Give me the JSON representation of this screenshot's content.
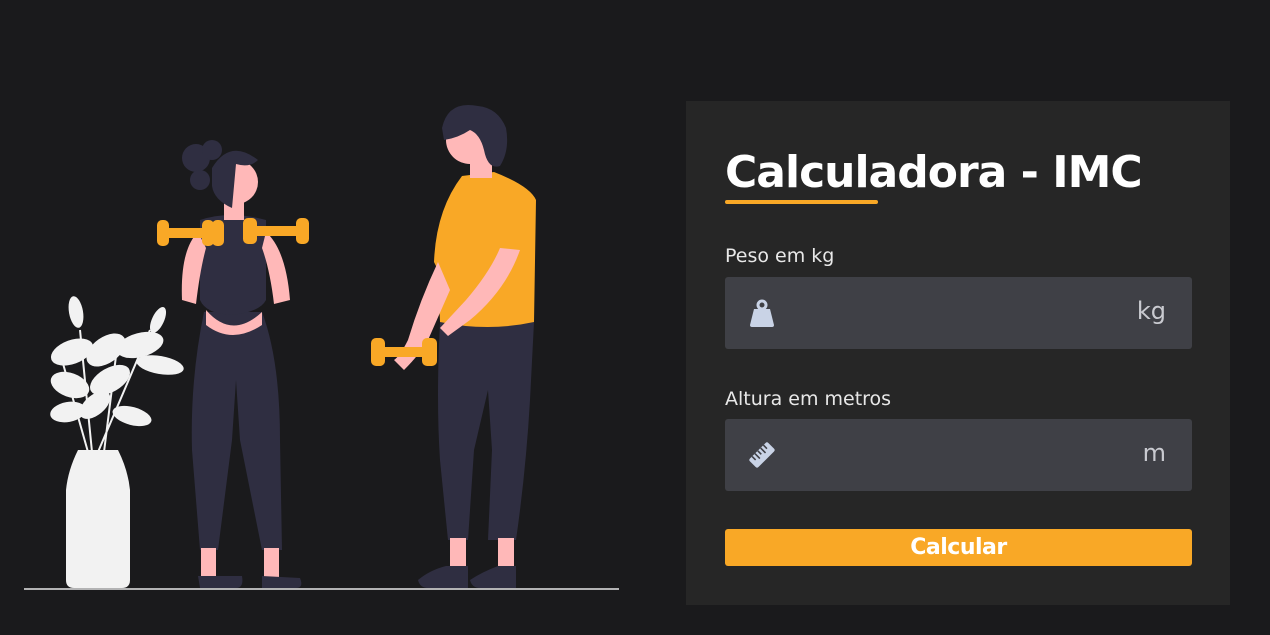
{
  "form": {
    "title": "Calculadora - IMC",
    "weight": {
      "label": "Peso em kg",
      "value": "",
      "placeholder": "",
      "unit": "kg",
      "icon": "weight-icon"
    },
    "height": {
      "label": "Altura em metros",
      "value": "",
      "placeholder": "",
      "unit": "m",
      "icon": "ruler-icon"
    },
    "button_label": "Calcular"
  },
  "illustration": {
    "subject": "two-people-exercising-with-dumbbells",
    "plant": "potted-plant"
  },
  "colors": {
    "background": "#1a1a1c",
    "panel": "#262626",
    "input": "#3f4046",
    "accent": "#f9a826",
    "figure_dark": "#2f2e41",
    "skin": "#ffb8b8",
    "plant": "#f2f2f2"
  }
}
